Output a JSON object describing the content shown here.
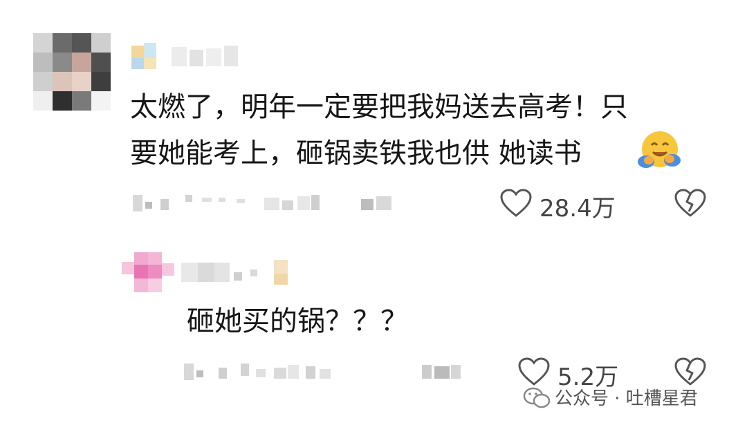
{
  "comment": {
    "line1": "太燃了，明年一定要把我妈送去高考！只",
    "line2": "要她能考上，砸锅卖铁我也供 她读书",
    "emoji_icon": "hugging-face",
    "likes": "28.4万",
    "like_icon": "heart-outline",
    "dislike_icon": "broken-heart-outline"
  },
  "reply": {
    "text": "砸她买的锅？？？",
    "likes": "5.2万",
    "like_icon": "heart-outline",
    "dislike_icon": "broken-heart-outline"
  },
  "watermark": {
    "icon": "wechat-icon",
    "text": "公众号 · 吐槽星君"
  }
}
